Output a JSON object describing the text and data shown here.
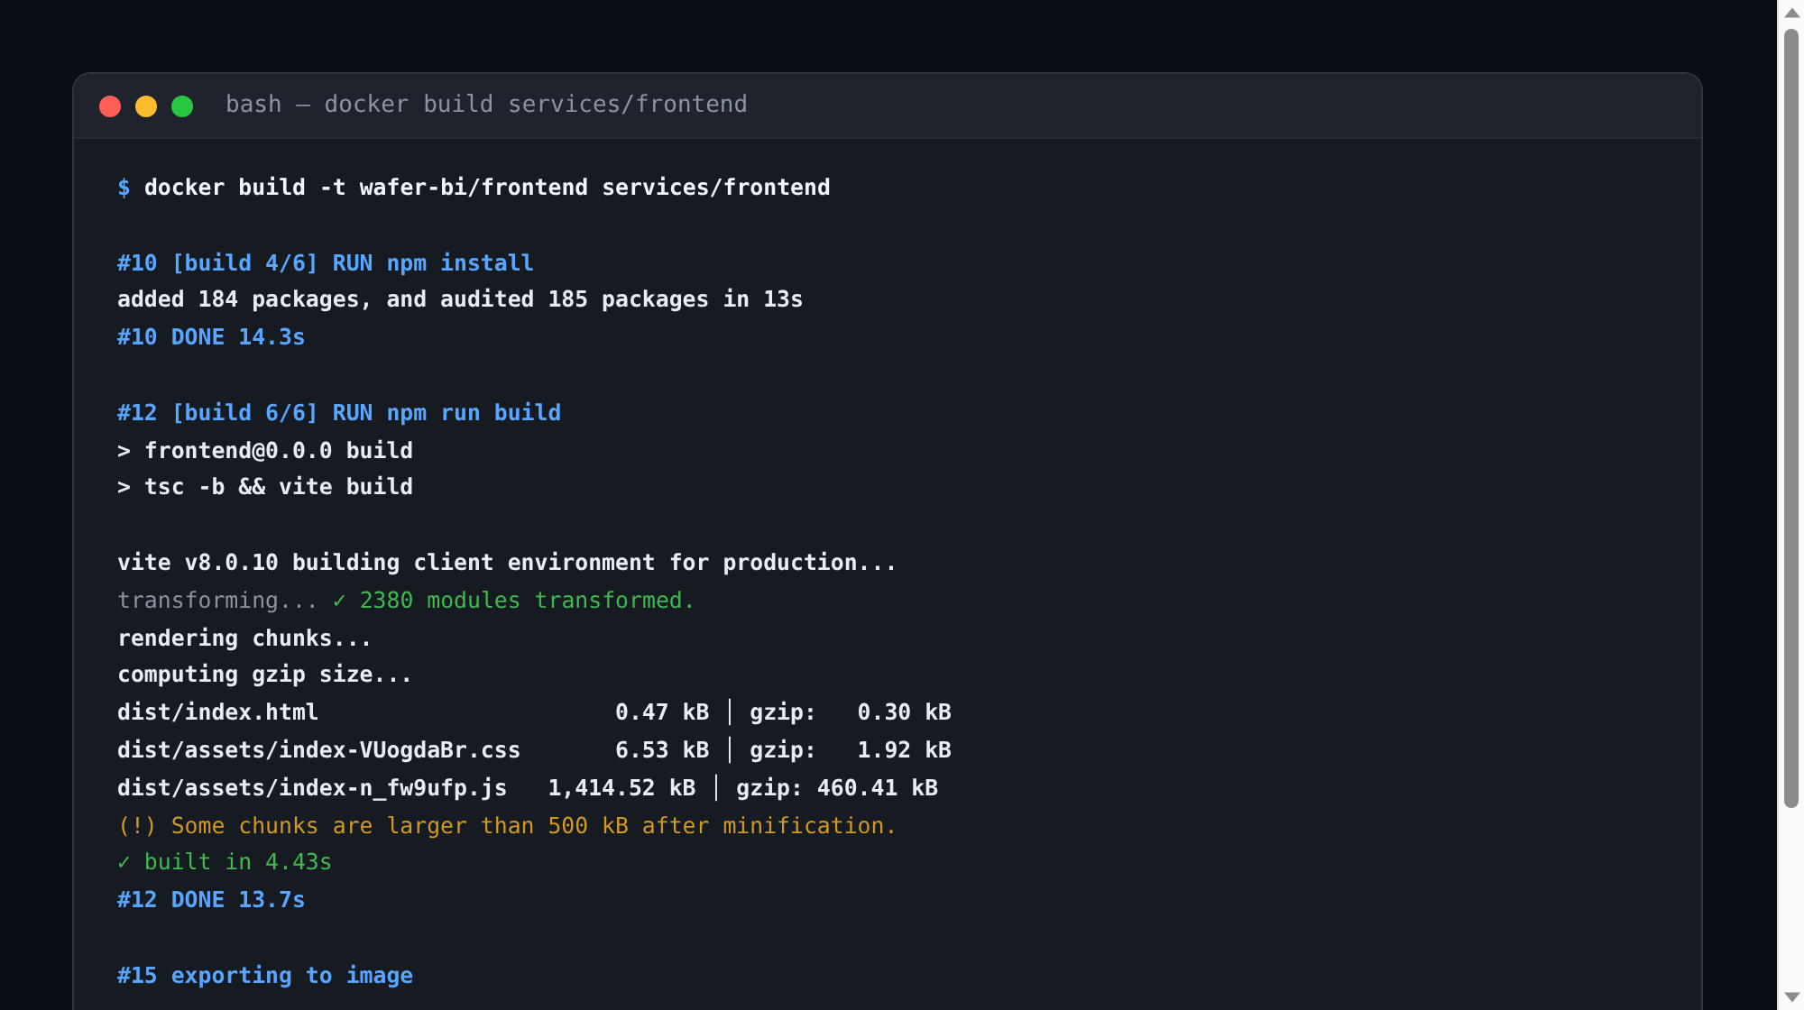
{
  "window": {
    "title": "bash — docker build services/frontend"
  },
  "terminal": {
    "lines": [
      {
        "kind": "text",
        "segments": [
          {
            "kind": "prompt",
            "text": "$"
          },
          {
            "kind": "command",
            "text": "docker build -t wafer-bi/frontend services/frontend"
          }
        ]
      },
      {
        "kind": "blank"
      },
      {
        "kind": "text",
        "segments": [
          {
            "kind": "info",
            "text": "#10 [build 4/6] RUN npm install"
          }
        ]
      },
      {
        "kind": "text",
        "segments": [
          {
            "kind": "plain",
            "text": "added 184 packages, and audited 185 packages in 13s"
          }
        ]
      },
      {
        "kind": "text",
        "segments": [
          {
            "kind": "info",
            "text": "#10 DONE 14.3s"
          }
        ]
      },
      {
        "kind": "blank"
      },
      {
        "kind": "text",
        "segments": [
          {
            "kind": "info",
            "text": "#12 [build 6/6] RUN npm run build"
          }
        ]
      },
      {
        "kind": "text",
        "segments": [
          {
            "kind": "plain",
            "text": "> frontend@0.0.0 build"
          }
        ]
      },
      {
        "kind": "text",
        "segments": [
          {
            "kind": "plain",
            "text": "> tsc -b && vite build"
          }
        ]
      },
      {
        "kind": "blank"
      },
      {
        "kind": "text",
        "segments": [
          {
            "kind": "plain",
            "text": "vite v8.0.10 building client environment for production..."
          }
        ]
      },
      {
        "kind": "text",
        "segments": [
          {
            "kind": "dim",
            "text": "transforming..."
          },
          {
            "kind": "success",
            "text": "✓ 2380 modules transformed."
          }
        ]
      },
      {
        "kind": "text",
        "segments": [
          {
            "kind": "plain",
            "text": "rendering chunks..."
          }
        ]
      },
      {
        "kind": "text",
        "segments": [
          {
            "kind": "plain",
            "text": "computing gzip size..."
          }
        ]
      },
      {
        "kind": "text",
        "segments": [
          {
            "kind": "plain",
            "text": "dist/index.html                      0.47 kB │ gzip:   0.30 kB"
          }
        ]
      },
      {
        "kind": "text",
        "segments": [
          {
            "kind": "plain",
            "text": "dist/assets/index-VUogdaBr.css       6.53 kB │ gzip:   1.92 kB"
          }
        ]
      },
      {
        "kind": "text",
        "segments": [
          {
            "kind": "plain",
            "text": "dist/assets/index-n_fw9ufp.js   1,414.52 kB │ gzip: 460.41 kB"
          }
        ]
      },
      {
        "kind": "text",
        "segments": [
          {
            "kind": "warn",
            "text": "(!) Some chunks are larger than 500 kB after minification."
          }
        ]
      },
      {
        "kind": "text",
        "segments": [
          {
            "kind": "success",
            "text": "✓ built in 4.43s"
          }
        ]
      },
      {
        "kind": "text",
        "segments": [
          {
            "kind": "info",
            "text": "#12 DONE 13.7s"
          }
        ]
      },
      {
        "kind": "blank"
      },
      {
        "kind": "text",
        "segments": [
          {
            "kind": "info",
            "text": "#15 exporting to image"
          }
        ]
      }
    ]
  }
}
